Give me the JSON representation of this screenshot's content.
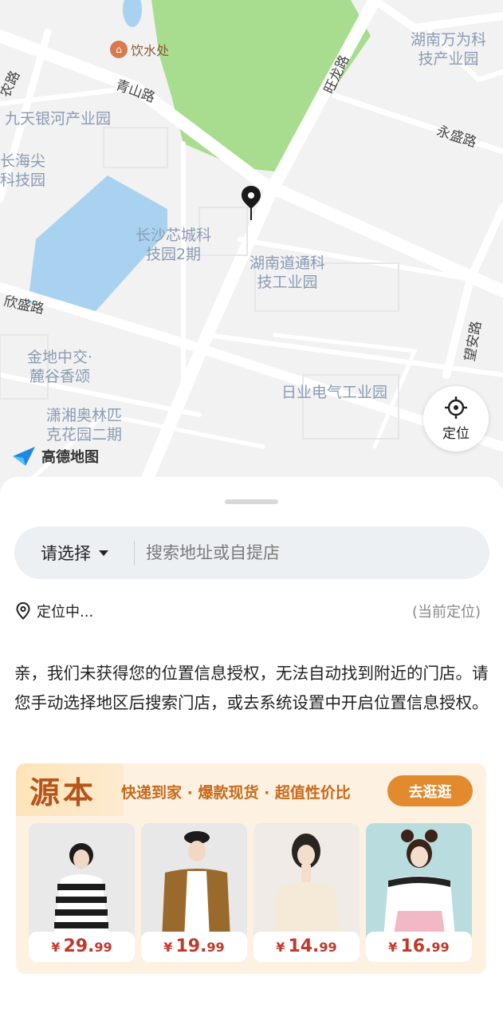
{
  "map": {
    "labels": {
      "hunan_wanwei": "湖南万为科\n技产业园",
      "jiutian": "九天银河产业园",
      "changhai": "长海尖\n科技园",
      "xincheng": "长沙芯城科\n技园2期",
      "daotong": "湖南道通科\n技工业园",
      "jindi": "金地中交·\n麓谷香颂",
      "riye": "日业电气工业园",
      "aolin": "潇湘奥林匹\n克花园二期"
    },
    "roads": {
      "qingshan": "青山路",
      "wanglong": "旺龙路",
      "yongsheng": "永盛路",
      "xinsheng": "欣盛路",
      "wangan": "望安路",
      "nong": "农路"
    },
    "poi_label": "饮水处",
    "locate_label": "定位",
    "logo_text": "高德地图"
  },
  "sheet": {
    "region_label": "请选择",
    "search_placeholder": "搜索地址或自提店",
    "locating_text": "定位中...",
    "current_location": "(当前定位)",
    "notice": "亲，我们未获得您的位置信息授权，无法自动找到附近的门店。请您手动选择地区后搜索门店，或去系统设置中开启位置信息授权。"
  },
  "banner": {
    "brand": "源本",
    "slogan": "快递到家 · 爆款现货 · 超值性价比",
    "button_label": "去逛逛",
    "products": [
      {
        "currency": "¥",
        "integer": "29.",
        "decimal": "99"
      },
      {
        "currency": "¥",
        "integer": "19.",
        "decimal": "99"
      },
      {
        "currency": "¥",
        "integer": "14.",
        "decimal": "99"
      },
      {
        "currency": "¥",
        "integer": "16.",
        "decimal": "99"
      }
    ]
  },
  "colors": {
    "accent": "#e18b2e",
    "price": "#c0392b",
    "park": "#a8dc8e",
    "water": "#a9d2f0"
  }
}
